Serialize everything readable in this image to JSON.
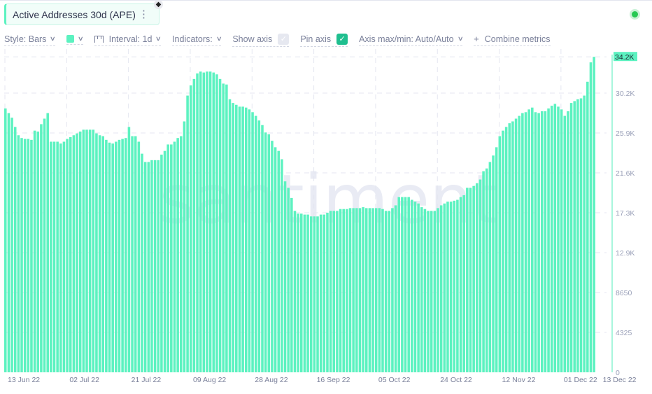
{
  "header": {
    "metric_label": "Active Addresses 30d (APE)",
    "more_icon": "⋮",
    "chain_icon": "ethereum-icon",
    "status": "online"
  },
  "toolbar": {
    "style_label": "Style: Bars",
    "color": "#5cf2c0",
    "interval_label": "Interval: 1d",
    "indicators_label": "Indicators:",
    "show_axis_label": "Show axis",
    "show_axis_checked": false,
    "pin_axis_label": "Pin axis",
    "pin_axis_checked": true,
    "axis_minmax_label": "Axis max/min: Auto/Auto",
    "combine_label": "Combine metrics"
  },
  "watermark": "santiment",
  "chart_data": {
    "type": "bar",
    "title": "Active Addresses 30d (APE)",
    "xlabel": "",
    "ylabel": "",
    "ylim": [
      0,
      35050
    ],
    "grid": true,
    "bar_color": "#5cf2c0",
    "start_date": "13 Jun 22",
    "end_date": "13 Dec 22",
    "last_value_label": "34.2K",
    "y_ticks": [
      {
        "value": 0,
        "label": "0"
      },
      {
        "value": 4325,
        "label": "4325"
      },
      {
        "value": 8650,
        "label": "8650"
      },
      {
        "value": 12975,
        "label": "12.9K"
      },
      {
        "value": 17300,
        "label": "17.3K"
      },
      {
        "value": 21625,
        "label": "21.6K"
      },
      {
        "value": 25950,
        "label": "25.9K"
      },
      {
        "value": 30275,
        "label": "30.2K"
      }
    ],
    "x_ticks": [
      {
        "index": 0,
        "label": "13 Jun 22"
      },
      {
        "index": 19,
        "label": "02 Jul 22"
      },
      {
        "index": 38,
        "label": "21 Jul 22"
      },
      {
        "index": 57,
        "label": "09 Aug 22"
      },
      {
        "index": 76,
        "label": "28 Aug 22"
      },
      {
        "index": 95,
        "label": "16 Sep 22"
      },
      {
        "index": 114,
        "label": "05 Oct 22"
      },
      {
        "index": 133,
        "label": "24 Oct 22"
      },
      {
        "index": 152,
        "label": "12 Nov 22"
      },
      {
        "index": 171,
        "label": "01 Dec 22"
      },
      {
        "index": 183,
        "label": "13 Dec 22"
      }
    ],
    "values": [
      28600,
      28100,
      27600,
      26600,
      25700,
      25400,
      25300,
      25300,
      25200,
      26200,
      26100,
      26900,
      27500,
      28100,
      25000,
      25000,
      25000,
      24800,
      25000,
      25300,
      25500,
      25700,
      25900,
      26100,
      26300,
      26300,
      26300,
      26300,
      25900,
      25700,
      25600,
      25200,
      24900,
      24800,
      25000,
      25200,
      25300,
      25400,
      26600,
      25600,
      25600,
      25000,
      23700,
      22800,
      22800,
      23000,
      23000,
      23000,
      23600,
      24000,
      24700,
      24700,
      25000,
      25400,
      25600,
      27200,
      30000,
      31100,
      31800,
      32400,
      32600,
      32500,
      32600,
      32600,
      32500,
      32300,
      31800,
      31300,
      31200,
      29600,
      29200,
      29000,
      28800,
      28800,
      28700,
      28500,
      28200,
      27800,
      27300,
      26800,
      26000,
      25800,
      25100,
      24400,
      24000,
      23100,
      20700,
      20000,
      18900,
      17500,
      17200,
      17200,
      17100,
      17100,
      16900,
      16900,
      16900,
      17100,
      17100,
      17300,
      17500,
      17500,
      17500,
      17700,
      17700,
      17700,
      17800,
      17800,
      17800,
      17800,
      17900,
      17800,
      17800,
      17800,
      17800,
      17800,
      17700,
      17500,
      17500,
      17800,
      18100,
      19000,
      19000,
      19000,
      19000,
      18700,
      18500,
      18300,
      17900,
      17700,
      17500,
      17500,
      17500,
      17800,
      18100,
      18300,
      18500,
      18500,
      18600,
      18700,
      19000,
      19200,
      20000,
      20000,
      20200,
      20500,
      20900,
      21800,
      22100,
      22800,
      23500,
      24400,
      25600,
      26200,
      26600,
      27000,
      27200,
      27500,
      27800,
      28100,
      28200,
      28500,
      28700,
      28200,
      28100,
      28300,
      28300,
      28600,
      28900,
      29100,
      28800,
      28500,
      27800,
      28300,
      29200,
      29400,
      29600,
      29700,
      30000,
      31500,
      33600,
      34200
    ]
  }
}
